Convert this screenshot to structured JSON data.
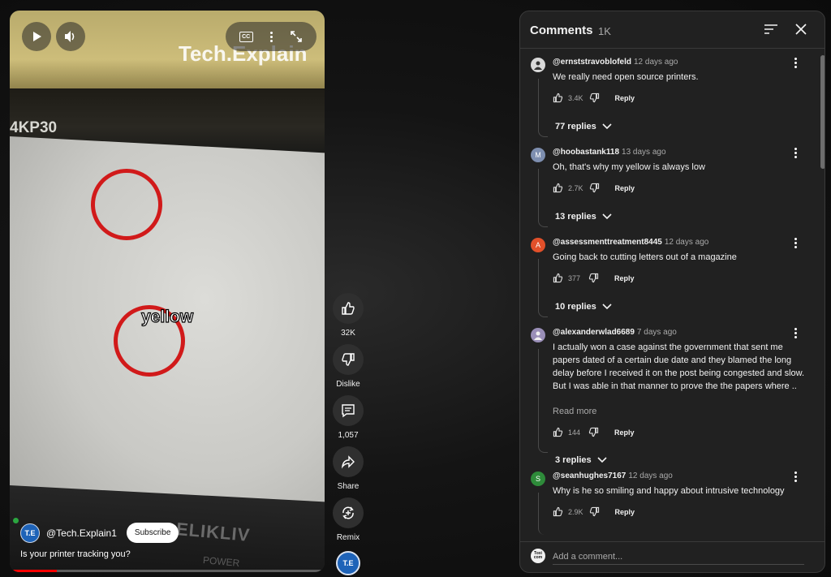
{
  "video": {
    "watermark": "Tech.Explain",
    "model_text": "4KP30",
    "overlay_label": "yellow",
    "brand_text": "ELIKLIV",
    "power_text": "POWER",
    "cc_label": "CC",
    "channel_avatar": "T.E",
    "channel_name": "@Tech.Explain1",
    "subscribe_label": "Subscribe",
    "caption": "Is your printer tracking you?",
    "progress_fraction": 0.15
  },
  "actions": {
    "like_count": "32K",
    "dislike_label": "Dislike",
    "comments_count": "1,057",
    "share_label": "Share",
    "remix_label": "Remix",
    "avatar_text": "T.E"
  },
  "comments_panel": {
    "title": "Comments",
    "count": "1K",
    "reply_label": "Reply",
    "read_more": "Read more",
    "input_placeholder": "Add a comment...",
    "user_avatar": "Toxi com",
    "comments": [
      {
        "author": "@ernststravoblofeld",
        "time": "12 days ago",
        "text": "We really need open source printers.",
        "likes": "3.4K",
        "replies": "77 replies",
        "avatar_letter": "",
        "avatar_color": "#d9d9d9"
      },
      {
        "author": "@hoobastank118",
        "time": "13 days ago",
        "text": "Oh, that's why my yellow is always low",
        "likes": "2.7K",
        "replies": "13 replies",
        "avatar_letter": "M",
        "avatar_color": "#7e8fb0"
      },
      {
        "author": "@assessmenttreatment8445",
        "time": "12 days ago",
        "text": "Going back to cutting letters out of a magazine",
        "likes": "377",
        "replies": "10 replies",
        "avatar_letter": "A",
        "avatar_color": "#e2502a"
      },
      {
        "author": "@alexanderwlad6689",
        "time": "7 days ago",
        "text": "I actually won a case against the government that sent me papers dated of a certain due date and they blamed the long delay before I received it on the post being congested and slow. But I was able in that manner to prove the the papers where ..",
        "likes": "144",
        "replies": "3 replies",
        "avatar_letter": "",
        "avatar_color": "#9a8fb8"
      },
      {
        "author": "@seanhughes7167",
        "time": "12 days ago",
        "text": "Why is he so smiling and happy about intrusive technology",
        "likes": "2.9K",
        "replies": "",
        "avatar_letter": "S",
        "avatar_color": "#2e8b3a"
      }
    ]
  }
}
